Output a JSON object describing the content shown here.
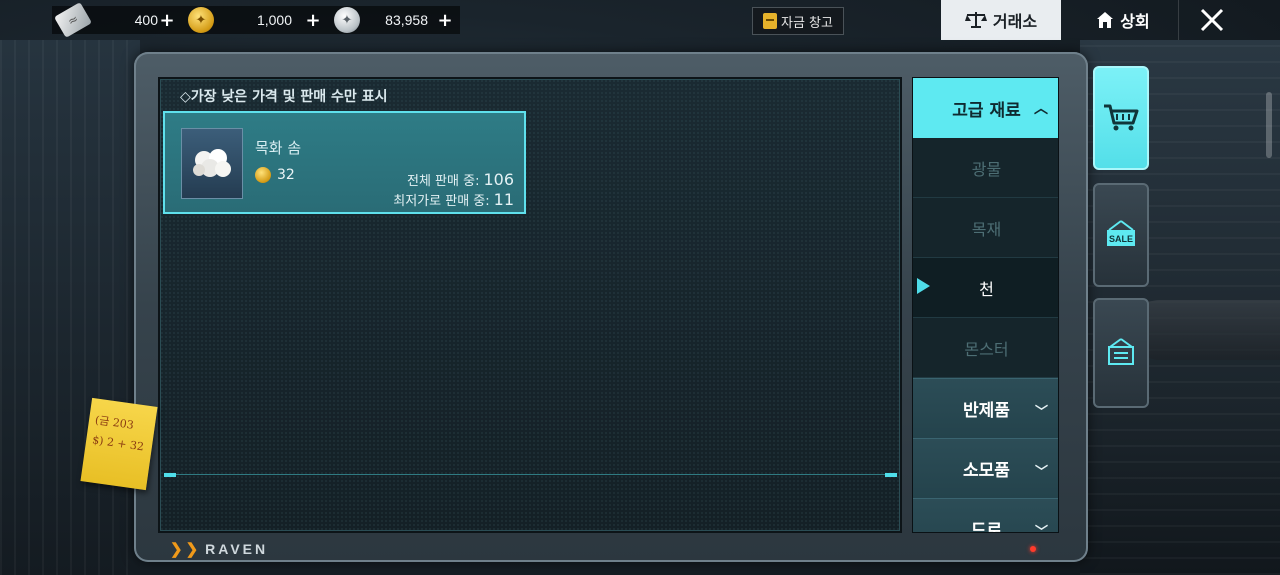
{
  "currencies": [
    {
      "icon": "ticket-icon",
      "value": "400"
    },
    {
      "icon": "gold-coin-icon",
      "value": "1,000"
    },
    {
      "icon": "silver-coin-icon",
      "value": "83,958"
    }
  ],
  "topbar": {
    "fund_storage": "자금 창고",
    "exchange": "거래소",
    "guild_shop": "상회"
  },
  "filter_label": "◇가장 낮은 가격 및 판매 수만 표시",
  "item": {
    "name": "목화 솜",
    "price": "32",
    "total_label": "전체 판매 중:",
    "total_value": "106",
    "lowest_label": "최저가로 판매 중:",
    "lowest_value": "11"
  },
  "categories": {
    "main": "고급 재료",
    "sub": [
      "광물",
      "목재",
      "천",
      "몬스터"
    ],
    "active_sub": "천",
    "groups": [
      "반제품",
      "소모품",
      "드로"
    ]
  },
  "side_tabs": [
    "cart-icon",
    "sale-tag-icon",
    "register-icon"
  ],
  "sale_tag_text": "SALE",
  "brand": "RAVEN",
  "note_lines": [
    "(금 203",
    "$) 2 + 32"
  ],
  "colors": {
    "accent": "#5ee9f1",
    "card": "#2e7c86",
    "gold": "#e6b22b"
  }
}
